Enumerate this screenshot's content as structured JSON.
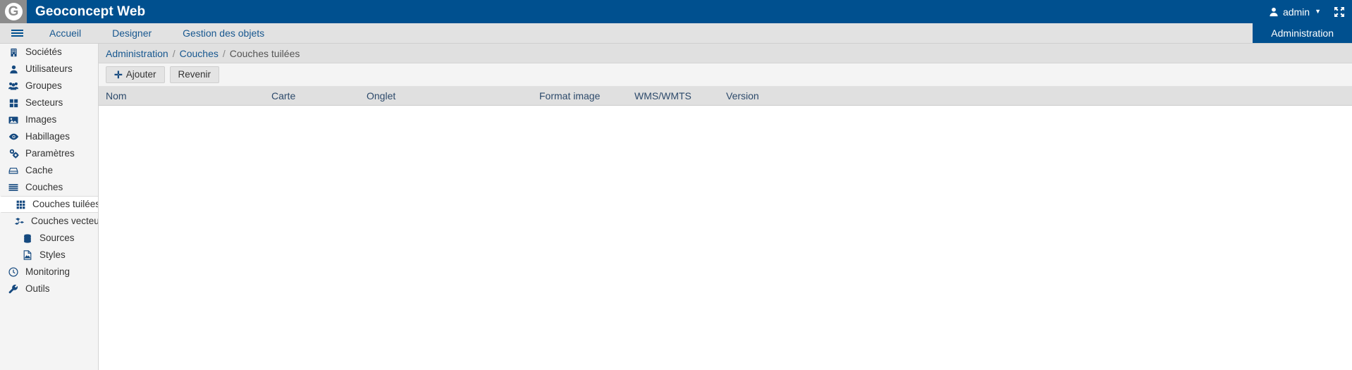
{
  "topbar": {
    "logo_letter": "G",
    "logo_icon": "geoconcept-logo-icon",
    "app_title": "Geoconcept Web",
    "user_icon": "user-icon",
    "user_name": "admin",
    "user_caret": "▼",
    "fullscreen_icon": "fullscreen-expand-icon"
  },
  "navbar": {
    "menu_icon": "hamburger-menu-icon",
    "items": [
      {
        "label": "Accueil",
        "name": "nav-accueil"
      },
      {
        "label": "Designer",
        "name": "nav-designer"
      },
      {
        "label": "Gestion des objets",
        "name": "nav-gestion-des-objets"
      }
    ],
    "active_tab": "Administration"
  },
  "sidebar": {
    "items": [
      {
        "label": "Sociétés",
        "icon": "building-icon",
        "level": 0,
        "active": false
      },
      {
        "label": "Utilisateurs",
        "icon": "user-icon",
        "level": 0,
        "active": false
      },
      {
        "label": "Groupes",
        "icon": "users-group-icon",
        "level": 0,
        "active": false
      },
      {
        "label": "Secteurs",
        "icon": "grid-squares-icon",
        "level": 0,
        "active": false
      },
      {
        "label": "Images",
        "icon": "image-icon",
        "level": 0,
        "active": false
      },
      {
        "label": "Habillages",
        "icon": "eye-icon",
        "level": 0,
        "active": false
      },
      {
        "label": "Paramètres",
        "icon": "gears-icon",
        "level": 0,
        "active": false
      },
      {
        "label": "Cache",
        "icon": "hdd-icon",
        "level": 0,
        "active": false
      },
      {
        "label": "Couches",
        "icon": "layers-bars-icon",
        "level": 0,
        "active": false
      },
      {
        "label": "Couches tuilées",
        "icon": "grid-dots-icon",
        "level": 1,
        "active": true
      },
      {
        "label": "Couches vecteurs",
        "icon": "vector-cubes-icon",
        "level": 1,
        "active": false
      },
      {
        "label": "Sources",
        "icon": "database-icon",
        "level": 2,
        "active": false
      },
      {
        "label": "Styles",
        "icon": "file-image-icon",
        "level": 2,
        "active": false
      },
      {
        "label": "Monitoring",
        "icon": "clock-icon",
        "level": 0,
        "active": false
      },
      {
        "label": "Outils",
        "icon": "wrench-icon",
        "level": 0,
        "active": false
      }
    ]
  },
  "breadcrumb": {
    "root": "Administration",
    "parent": "Couches",
    "current": "Couches tuilées",
    "separator": "/"
  },
  "toolbar": {
    "add_label": "Ajouter",
    "add_icon": "plus-icon",
    "back_label": "Revenir"
  },
  "table": {
    "columns": [
      "Nom",
      "Carte",
      "Onglet",
      "Format image",
      "WMS/WMTS",
      "Version"
    ],
    "rows": []
  },
  "colors": {
    "brand_blue": "#00508f",
    "link_blue": "#17578f",
    "icon_blue": "#15497f",
    "navbar_gray": "#e2e2e2",
    "sidebar_gray": "#f4f4f4",
    "header_gray": "#e0e0e0"
  }
}
